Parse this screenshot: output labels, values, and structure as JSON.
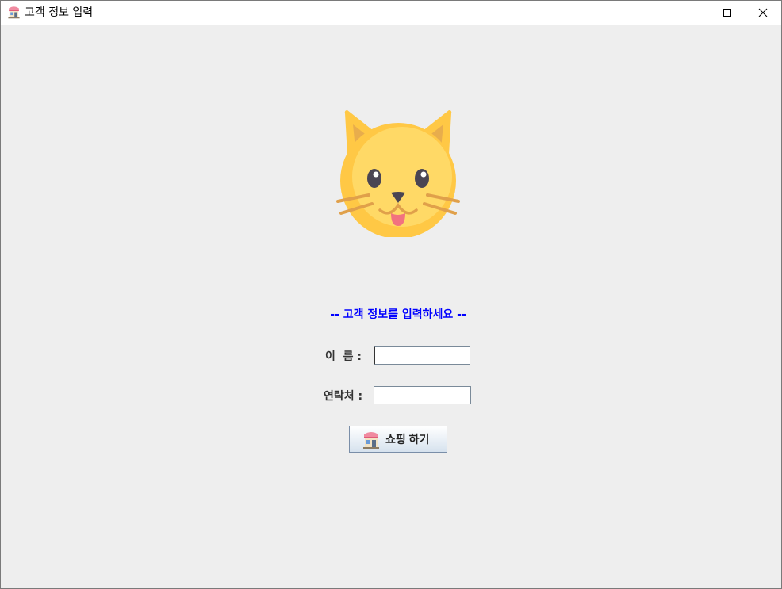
{
  "window": {
    "title": "고객 정보 입력",
    "icon": "shop-icon",
    "controls": [
      "minimize-icon",
      "maximize-icon",
      "close-icon"
    ]
  },
  "main": {
    "illustration": "cat-face-icon",
    "prompt": "-- 고객 정보를 입력하세요 --",
    "form": {
      "name_label": "이  름 :",
      "name_value": "",
      "phone_label": "연락처 :",
      "phone_value": ""
    },
    "shop_button": {
      "label": "쇼핑 하기",
      "icon": "shop-icon"
    }
  },
  "colors": {
    "prompt": "#0000ff",
    "background": "#eeeeee",
    "cat_face": "#ffd15c"
  }
}
